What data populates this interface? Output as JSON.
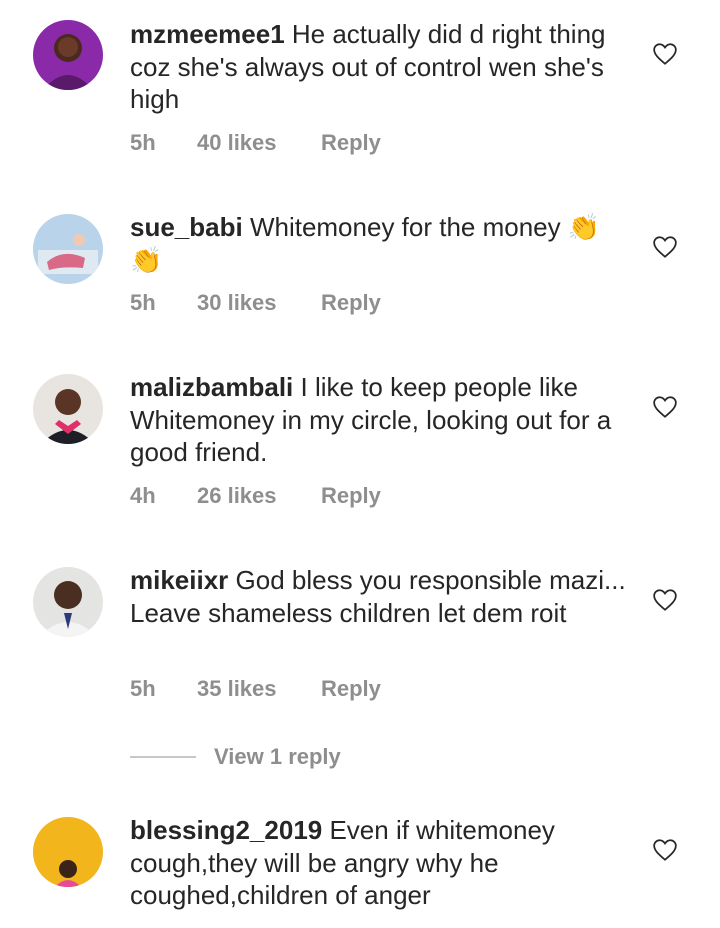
{
  "comments": [
    {
      "username": "mzmeemee1",
      "text": " He actually did d right thing coz she's always out of control wen she's high",
      "time": "5h",
      "likes": "40 likes",
      "reply": "Reply"
    },
    {
      "username": "sue_babi",
      "text": " Whitemoney for the money 👏 👏",
      "time": "5h",
      "likes": "30 likes",
      "reply": "Reply"
    },
    {
      "username": "malizbambali",
      "text": " I like to keep people like Whitemoney in my circle, looking out for a good friend.",
      "time": "4h",
      "likes": "26 likes",
      "reply": "Reply"
    },
    {
      "username": "mikeiixr",
      "text": " God bless you responsible mazi... Leave shameless children let dem roit",
      "time": "5h",
      "likes": "35 likes",
      "reply": "Reply"
    },
    {
      "username": "blessing2_2019",
      "text": " Even if whitemoney cough,they will be angry why he coughed,children of anger"
    }
  ],
  "view_replies": "View 1 reply",
  "icons": {
    "like": "heart-outline-icon"
  },
  "colors": {
    "text": "#262626",
    "meta": "#8e8e8e",
    "divider": "#c7c7c7"
  }
}
